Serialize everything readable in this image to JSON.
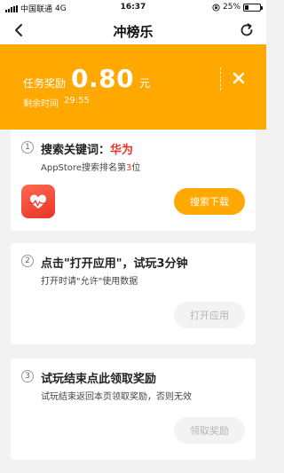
{
  "status_bar": {
    "carrier": "中国联通",
    "network": "4G",
    "time": "16:37",
    "battery": "25%",
    "battery_level": 0.25
  },
  "nav": {
    "title": "冲榜乐"
  },
  "banner": {
    "reward_label": "任务奖励",
    "reward_amount": "0.80",
    "reward_unit": "元",
    "remain_label": "剩余时间",
    "remain_time": "29:55"
  },
  "steps": [
    {
      "number": "1",
      "title_prefix": "搜索关键词：",
      "keyword": "华为",
      "desc_prefix": "AppStore搜索排名第",
      "rank": "3",
      "desc_suffix": "位",
      "button": "搜索下载"
    },
    {
      "number": "2",
      "title": "点击\"打开应用\"，试玩3分钟",
      "desc": "打开时请\"允许\"使用数据",
      "button": "打开应用"
    },
    {
      "number": "3",
      "title": "试玩结束点此领取奖励",
      "desc": "试玩结束返回本页领取奖励，否则无效",
      "button": "领取奖励"
    }
  ],
  "colors": {
    "accent": "#ffa800",
    "keyword": "#e8342a",
    "disabled_button": "#f3f3f3"
  }
}
